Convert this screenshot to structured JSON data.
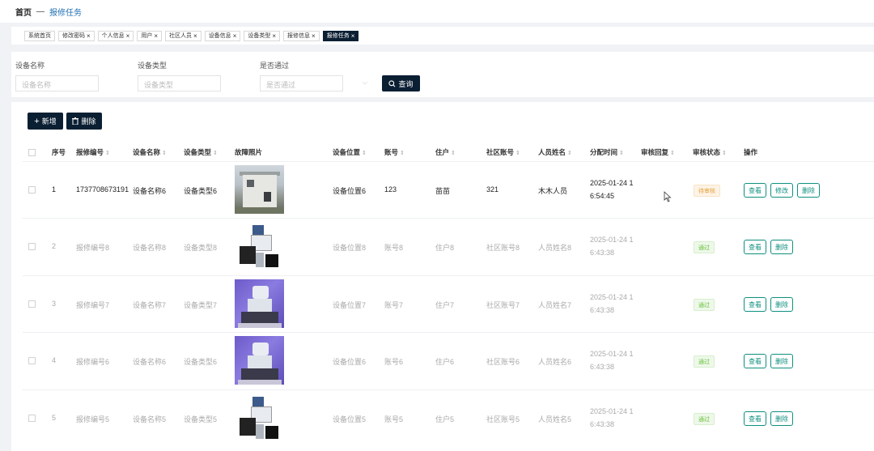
{
  "breadcrumb": {
    "home": "首页",
    "separator": "—",
    "current": "报修任务"
  },
  "tags": [
    {
      "label": "系统首页",
      "closable": false,
      "active": false
    },
    {
      "label": "修改密码",
      "closable": true,
      "active": false
    },
    {
      "label": "个人信息",
      "closable": true,
      "active": false
    },
    {
      "label": "用户",
      "closable": true,
      "active": false
    },
    {
      "label": "社区人员",
      "closable": true,
      "active": false
    },
    {
      "label": "设备信息",
      "closable": true,
      "active": false
    },
    {
      "label": "设备类型",
      "closable": true,
      "active": false
    },
    {
      "label": "报修信息",
      "closable": true,
      "active": false
    },
    {
      "label": "报修任务",
      "closable": true,
      "active": true
    }
  ],
  "filters": {
    "name_label": "设备名称",
    "name_placeholder": "设备名称",
    "type_label": "设备类型",
    "type_placeholder": "设备类型",
    "pass_label": "是否通过",
    "pass_placeholder": "是否通过",
    "query_label": "查询"
  },
  "toolbar": {
    "add_label": "新增",
    "delete_label": "删除"
  },
  "columns": {
    "index": "序号",
    "repair_no": "报修编号",
    "device_name": "设备名称",
    "device_type": "设备类型",
    "photo": "故障照片",
    "location": "设备位置",
    "account": "账号",
    "resident": "住户",
    "community_account": "社区账号",
    "staff_name": "人员姓名",
    "assign_time": "分配时间",
    "audit_reply": "审核回复",
    "audit_status": "审核状态",
    "actions": "操作"
  },
  "actions": {
    "view": "查看",
    "edit": "修改",
    "delete": "删除"
  },
  "rows": [
    {
      "index": "1",
      "repair_no": "1737708673191",
      "device_name": "设备名称6",
      "device_type": "设备类型6",
      "photo": "house",
      "location": "设备位置6",
      "account": "123",
      "resident": "苗苗",
      "community_account": "321",
      "staff_name": "木木人员",
      "time1": "2025-01-24 1",
      "time2": "6:54:45",
      "status": "待审核",
      "status_kind": "pend",
      "editable": true
    },
    {
      "index": "2",
      "repair_no": "报修编号8",
      "device_name": "设备名称8",
      "device_type": "设备类型8",
      "photo": "lab",
      "location": "设备位置8",
      "account": "账号8",
      "resident": "住户8",
      "community_account": "社区账号8",
      "staff_name": "人员姓名8",
      "time1": "2025-01-24 1",
      "time2": "6:43:38",
      "status": "通过",
      "status_kind": "ok",
      "editable": false
    },
    {
      "index": "3",
      "repair_no": "报修编号7",
      "device_name": "设备名称7",
      "device_type": "设备类型7",
      "photo": "purple",
      "location": "设备位置7",
      "account": "账号7",
      "resident": "住户7",
      "community_account": "社区账号7",
      "staff_name": "人员姓名7",
      "time1": "2025-01-24 1",
      "time2": "6:43:38",
      "status": "通过",
      "status_kind": "ok",
      "editable": false
    },
    {
      "index": "4",
      "repair_no": "报修编号6",
      "device_name": "设备名称6",
      "device_type": "设备类型6",
      "photo": "purple",
      "location": "设备位置6",
      "account": "账号6",
      "resident": "住户6",
      "community_account": "社区账号6",
      "staff_name": "人员姓名6",
      "time1": "2025-01-24 1",
      "time2": "6:43:38",
      "status": "通过",
      "status_kind": "ok",
      "editable": false
    },
    {
      "index": "5",
      "repair_no": "报修编号5",
      "device_name": "设备名称5",
      "device_type": "设备类型5",
      "photo": "lab",
      "location": "设备位置5",
      "account": "账号5",
      "resident": "住户5",
      "community_account": "社区账号5",
      "staff_name": "人员姓名5",
      "time1": "2025-01-24 1",
      "time2": "6:43:38",
      "status": "通过",
      "status_kind": "ok",
      "editable": false
    }
  ]
}
